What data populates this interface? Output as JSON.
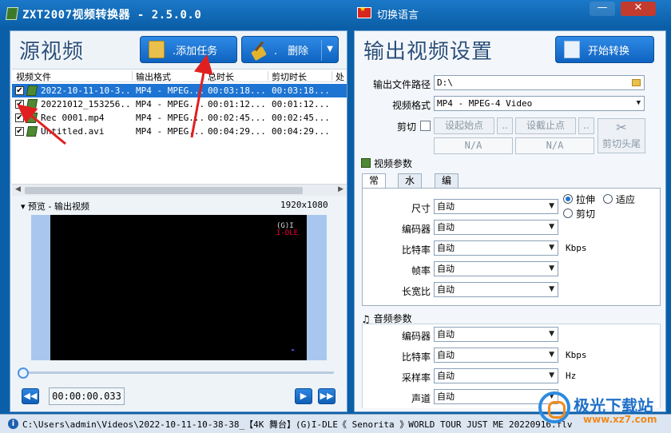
{
  "titlebar": {
    "title": "ZXT2007视频转换器 - 2.5.0.0",
    "language_label": "切换语言",
    "minimize": "—",
    "close": "✕"
  },
  "left": {
    "title": "源视频",
    "add_task_label": ".添加任务",
    "delete_label": ".　删除",
    "table": {
      "headers": [
        "视频文件",
        "输出格式",
        "总时长",
        "剪切时长",
        "处"
      ],
      "rows": [
        {
          "checked": true,
          "name": "2022-10-11-10-3...",
          "format": "MP4 - MPEG...",
          "total": "00:03:18...",
          "cut": "00:03:18...",
          "selected": true
        },
        {
          "checked": true,
          "name": "20221012_153256...",
          "format": "MP4 - MPEG...",
          "total": "00:01:12...",
          "cut": "00:01:12...",
          "selected": false
        },
        {
          "checked": true,
          "name": "Rec 0001.mp4",
          "format": "MP4 - MPEG...",
          "total": "00:02:45...",
          "cut": "00:02:45...",
          "selected": false
        },
        {
          "checked": true,
          "name": "Untitled.avi",
          "format": "MP4 - MPEG...",
          "total": "00:04:29...",
          "cut": "00:04:29...",
          "selected": false
        }
      ]
    },
    "preview_label": "▾ 预览 - 输出视频",
    "preview_resolution": "1920x1080",
    "video_logo_line1": "(G)I",
    "video_logo_line2": "I-DLE",
    "time": "00:00:00.033",
    "seek_position": 0
  },
  "right": {
    "title": "输出视频设置",
    "start_label": "开始转换",
    "output_path_label": "输出文件路径",
    "output_path": "D:\\",
    "video_format_label": "视频格式",
    "video_format": "MP4 - MPEG-4 Video",
    "cut_label": "剪切",
    "set_start": "设起始点",
    "set_end": "设截止点",
    "start_value": "N/A",
    "end_value": "N/A",
    "cut_head_tail": "剪切头尾",
    "video_params_label": "视频参数",
    "tabs": [
      "常规",
      "水印",
      "编辑"
    ],
    "video_fields": [
      {
        "label": "尺寸",
        "value": "自动",
        "unit": ""
      },
      {
        "label": "编码器",
        "value": "自动",
        "unit": ""
      },
      {
        "label": "比特率",
        "value": "自动",
        "unit": "Kbps"
      },
      {
        "label": "帧率",
        "value": "自动",
        "unit": ""
      },
      {
        "label": "长宽比",
        "value": "自动",
        "unit": ""
      }
    ],
    "stretch_label": "拉伸",
    "fit_label": "适应",
    "crop_label": "剪切",
    "audio_params_label": "音频参数",
    "audio_fields": [
      {
        "label": "编码器",
        "value": "自动",
        "unit": ""
      },
      {
        "label": "比特率",
        "value": "自动",
        "unit": "Kbps"
      },
      {
        "label": "采样率",
        "value": "自动",
        "unit": "Hz"
      },
      {
        "label": "声道",
        "value": "自动",
        "unit": ""
      }
    ]
  },
  "status": {
    "path": "C:\\Users\\admin\\Videos\\2022-10-11-10-38-38_【4K 舞台】(G)I-DLE《 Senorita 》WORLD TOUR JUST ME 20220916.flv"
  },
  "watermark": {
    "name": "极光下载站",
    "url": "www.xz7.com"
  },
  "colors": {
    "accent": "#1e74d2",
    "titlebar": "#0b5fa8",
    "annotation": "#e02020"
  }
}
